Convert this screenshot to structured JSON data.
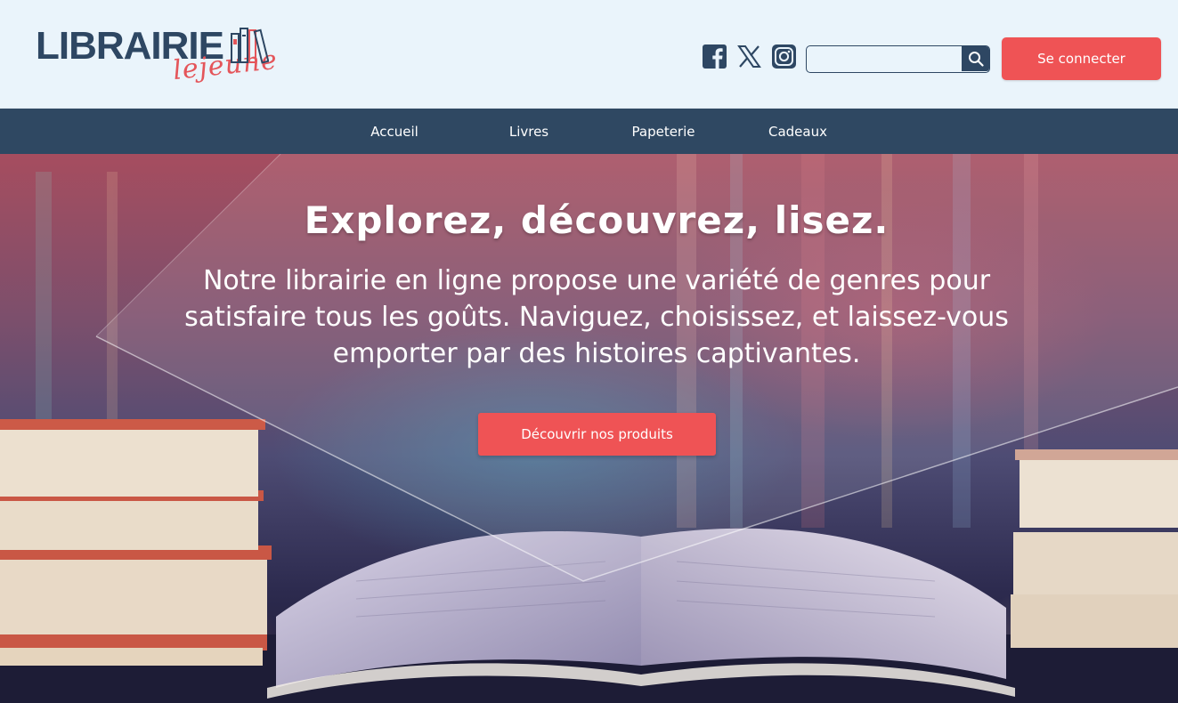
{
  "header": {
    "logo": {
      "main": "LIBRAIRIE",
      "script": "lejeune"
    },
    "socials": [
      {
        "icon": "facebook-icon"
      },
      {
        "icon": "x-icon"
      },
      {
        "icon": "instagram-icon"
      }
    ],
    "search": {
      "value": "",
      "placeholder": "",
      "icon": "search-icon"
    },
    "login_label": "Se connecter"
  },
  "nav": {
    "items": [
      {
        "label": "Accueil"
      },
      {
        "label": "Livres"
      },
      {
        "label": "Papeterie"
      },
      {
        "label": "Cadeaux"
      }
    ]
  },
  "hero": {
    "title": "Explorez, découvrez, lisez.",
    "text": "Notre librairie en ligne propose une variété de genres pour satisfaire tous les goûts. Naviguez, choisissez, et laissez-vous emporter par des histoires captivantes.",
    "cta_label": "Découvrir nos produits"
  },
  "colors": {
    "primary": "#2f4862",
    "accent": "#ef5355",
    "header_bg": "#eaf4fb",
    "white": "#ffffff"
  }
}
